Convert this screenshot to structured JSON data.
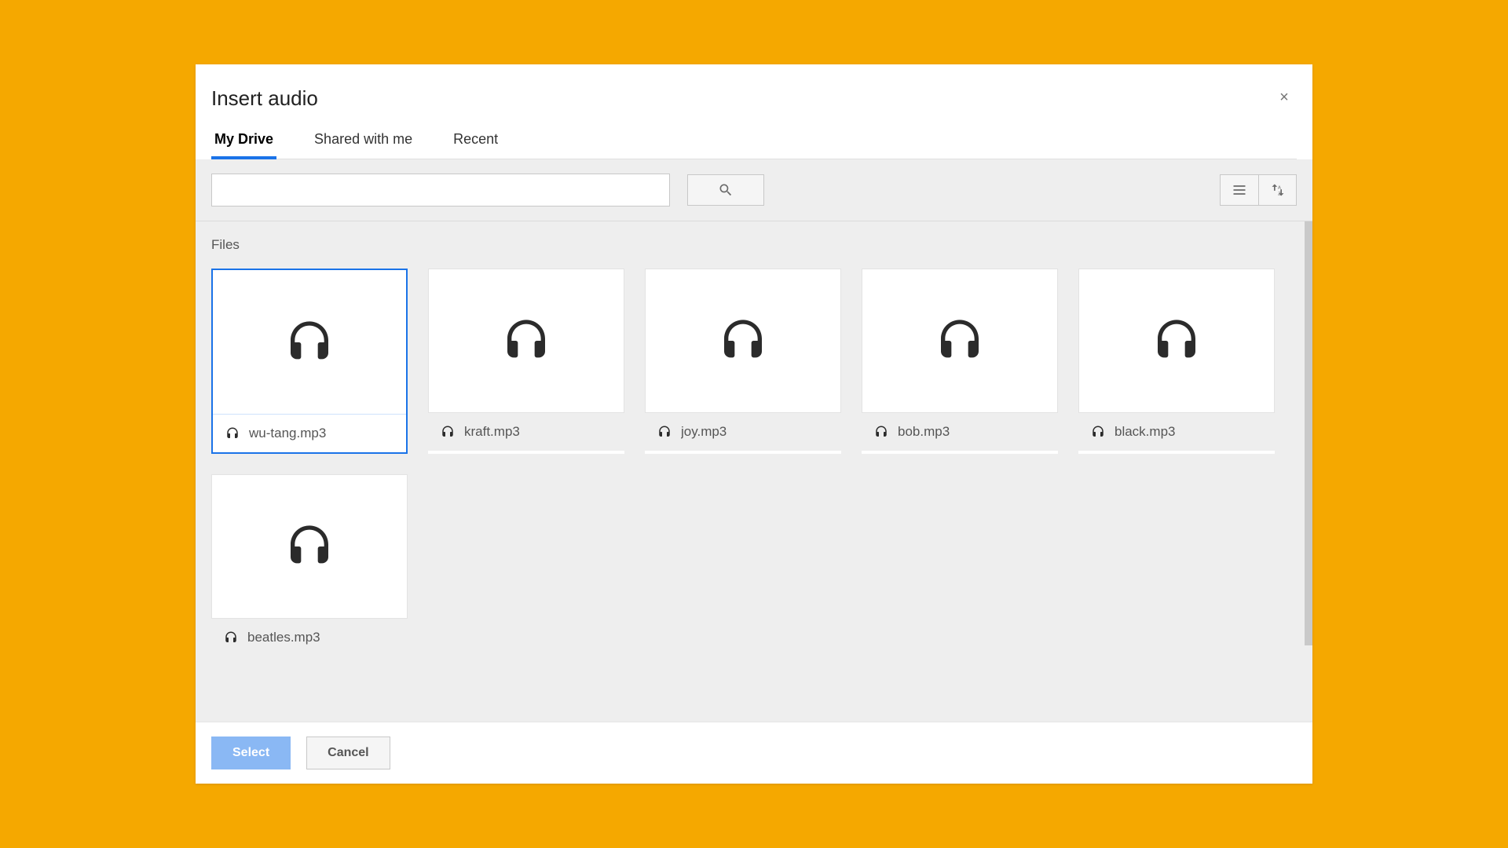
{
  "dialog": {
    "title": "Insert audio",
    "close_glyph": "×"
  },
  "tabs": [
    {
      "label": "My Drive",
      "active": true
    },
    {
      "label": "Shared with me",
      "active": false
    },
    {
      "label": "Recent",
      "active": false
    }
  ],
  "search": {
    "value": "",
    "placeholder": ""
  },
  "section": {
    "label": "Files"
  },
  "files": [
    {
      "name": "wu-tang.mp3",
      "icon": "headphones-icon",
      "selected": true
    },
    {
      "name": "kraft.mp3",
      "icon": "headphones-icon",
      "selected": false
    },
    {
      "name": "joy.mp3",
      "icon": "headphones-icon",
      "selected": false
    },
    {
      "name": "bob.mp3",
      "icon": "headphones-icon",
      "selected": false
    },
    {
      "name": "black.mp3",
      "icon": "headphones-icon",
      "selected": false
    },
    {
      "name": "beatles.mp3",
      "icon": "headphones-icon",
      "selected": false
    }
  ],
  "footer": {
    "select_label": "Select",
    "cancel_label": "Cancel"
  },
  "colors": {
    "accent": "#1a73e8",
    "page_bg": "#f5a800",
    "panel_bg": "#eeeeee"
  }
}
